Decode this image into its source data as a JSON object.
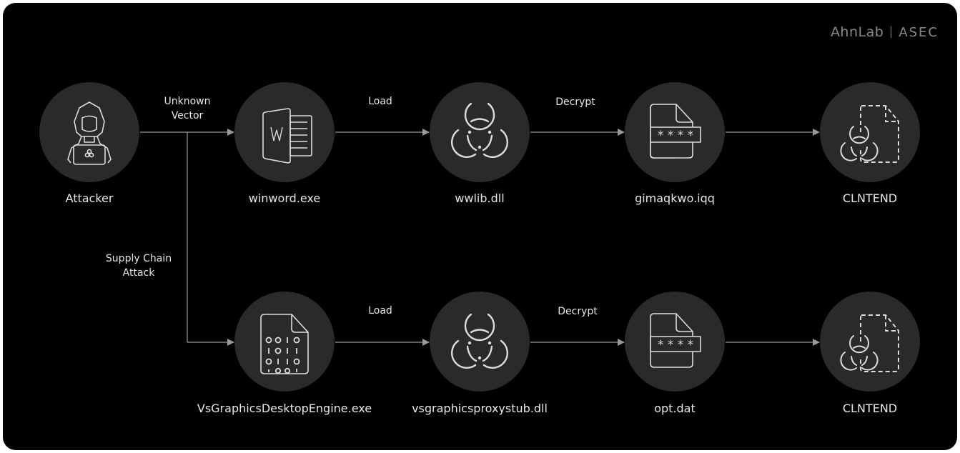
{
  "brand": {
    "company": "AhnLab",
    "team": "ASEC"
  },
  "colors": {
    "background": "#000000",
    "node_fill": "#2a2a2a",
    "icon_stroke": "#dcdcdc",
    "edge": "#9a9a9a",
    "text": "#e6e6e6"
  },
  "nodes": {
    "attacker": {
      "label": "Attacker",
      "icon": "hooded-hacker-laptop-icon"
    },
    "top": [
      {
        "label": "winword.exe",
        "icon": "word-document-icon"
      },
      {
        "label": "wwlib.dll",
        "icon": "biohazard-icon"
      },
      {
        "label": "gimaqkwo.iqq",
        "icon": "encrypted-file-icon"
      },
      {
        "label": "CLNTEND",
        "icon": "biohazard-dashed-file-icon"
      }
    ],
    "bottom": [
      {
        "label": "VsGraphicsDesktopEngine.exe",
        "icon": "binary-file-icon"
      },
      {
        "label": "vsgraphicsproxystub.dll",
        "icon": "biohazard-icon"
      },
      {
        "label": "opt.dat",
        "icon": "encrypted-file-icon"
      },
      {
        "label": "CLNTEND",
        "icon": "biohazard-dashed-file-icon"
      }
    ]
  },
  "edges": {
    "unknown_vector": [
      "Unknown",
      "Vector"
    ],
    "supply_chain": [
      "Supply Chain",
      "Attack"
    ],
    "top": [
      "Load",
      "Decrypt",
      ""
    ],
    "bottom": [
      "Load",
      "Decrypt",
      ""
    ]
  },
  "encrypted_mask": "* * * *"
}
